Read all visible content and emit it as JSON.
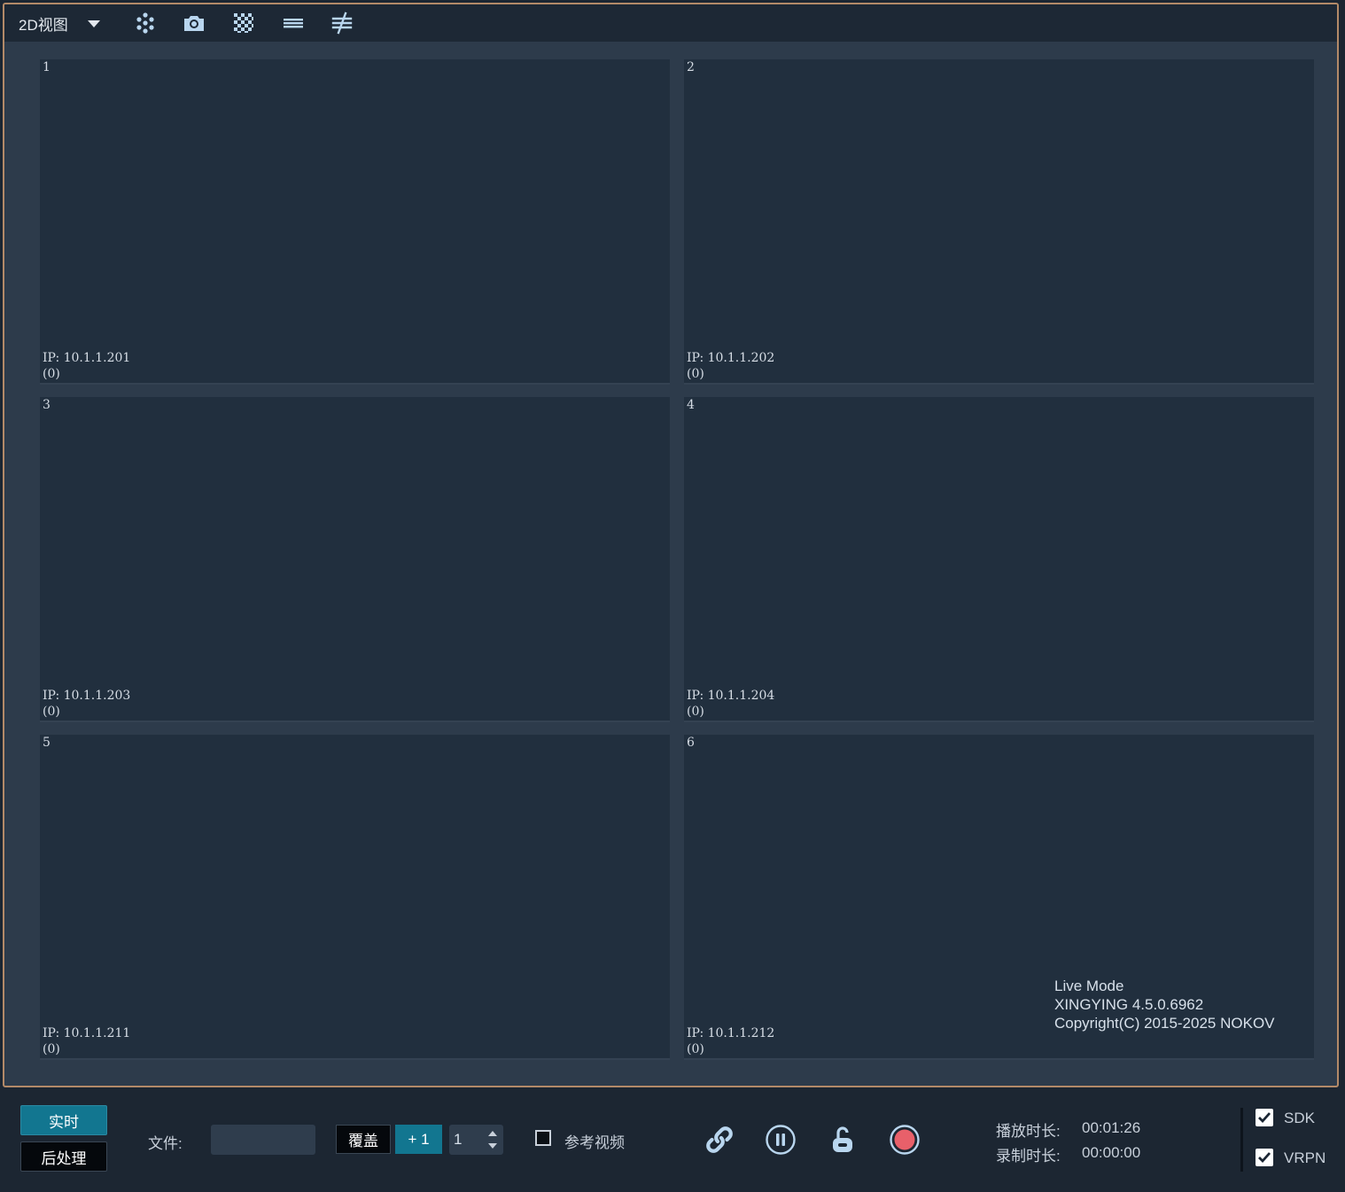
{
  "toolbar": {
    "view_label": "2D视图",
    "icons": [
      "markers-icon",
      "camera-snapshot-icon",
      "checker-mask-icon",
      "menu-lines-icon",
      "not-equal-filter-icon"
    ]
  },
  "cameras": [
    {
      "num": "1",
      "ip": "IP: 10.1.1.201",
      "count": "(0)"
    },
    {
      "num": "2",
      "ip": "IP: 10.1.1.202",
      "count": "(0)"
    },
    {
      "num": "3",
      "ip": "IP: 10.1.1.203",
      "count": "(0)"
    },
    {
      "num": "4",
      "ip": "IP: 10.1.1.204",
      "count": "(0)"
    },
    {
      "num": "5",
      "ip": "IP: 10.1.1.211",
      "count": "(0)"
    },
    {
      "num": "6",
      "ip": "IP: 10.1.1.212",
      "count": "(0)"
    }
  ],
  "overlay": {
    "mode": "Live Mode",
    "version": "XINGYING 4.5.0.6962",
    "copyright": "Copyright(C) 2015-2025 NOKOV"
  },
  "bottom": {
    "live_label": "实时",
    "post_label": "后处理",
    "file_label": "文件:",
    "file_value": "",
    "overwrite_label": "覆盖",
    "plus_label": "+ 1",
    "spin_value": "1",
    "ref_video_label": "参考视频",
    "ref_video_checked": false,
    "play_duration_label": "播放时长:",
    "play_duration_value": "00:01:26",
    "record_duration_label": "录制时长:",
    "record_duration_value": "00:00:00",
    "sdk_label": "SDK",
    "sdk_checked": true,
    "vrpn_label": "VRPN",
    "vrpn_checked": true
  },
  "colors": {
    "accent": "#127690",
    "frame_border": "#b38a68",
    "record": "#e8606a",
    "icon": "#b9d6ef"
  }
}
